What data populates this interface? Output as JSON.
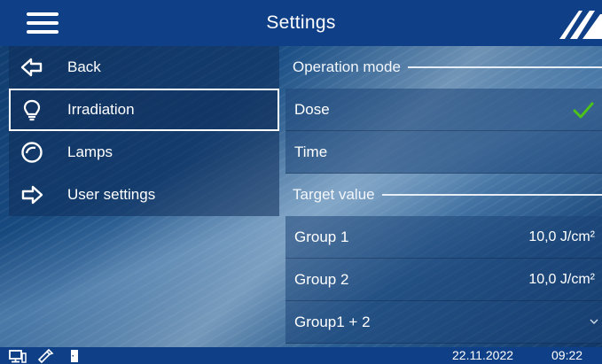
{
  "header": {
    "title": "Settings",
    "menu_icon": "hamburger-menu-icon",
    "logo_icon": "brand-logo-icon"
  },
  "menu": {
    "items": [
      {
        "label": "Back",
        "icon": "arrow-left-icon"
      },
      {
        "label": "Irradiation",
        "icon": "lightbulb-icon",
        "selected": true
      },
      {
        "label": "Lamps",
        "icon": "lamp-ring-icon"
      },
      {
        "label": "User settings",
        "icon": "arrow-right-icon"
      }
    ]
  },
  "panel": {
    "operation_mode": {
      "heading": "Operation mode",
      "options": [
        {
          "label": "Dose",
          "checked": true
        },
        {
          "label": "Time",
          "checked": false
        }
      ]
    },
    "target_value": {
      "heading": "Target value",
      "rows": [
        {
          "label": "Group 1",
          "value": "10,0 J/cm²"
        },
        {
          "label": "Group 2",
          "value": "10,0 J/cm²"
        },
        {
          "label": "Group1 + 2",
          "value": ""
        }
      ]
    }
  },
  "statusbar": {
    "date": "22.11.2022",
    "time": "09:22",
    "icons": [
      "computer-icon",
      "usb-stick-icon",
      "door-icon"
    ]
  },
  "colors": {
    "header_bg": "#0f3f86",
    "check_green": "#4cc21a"
  }
}
